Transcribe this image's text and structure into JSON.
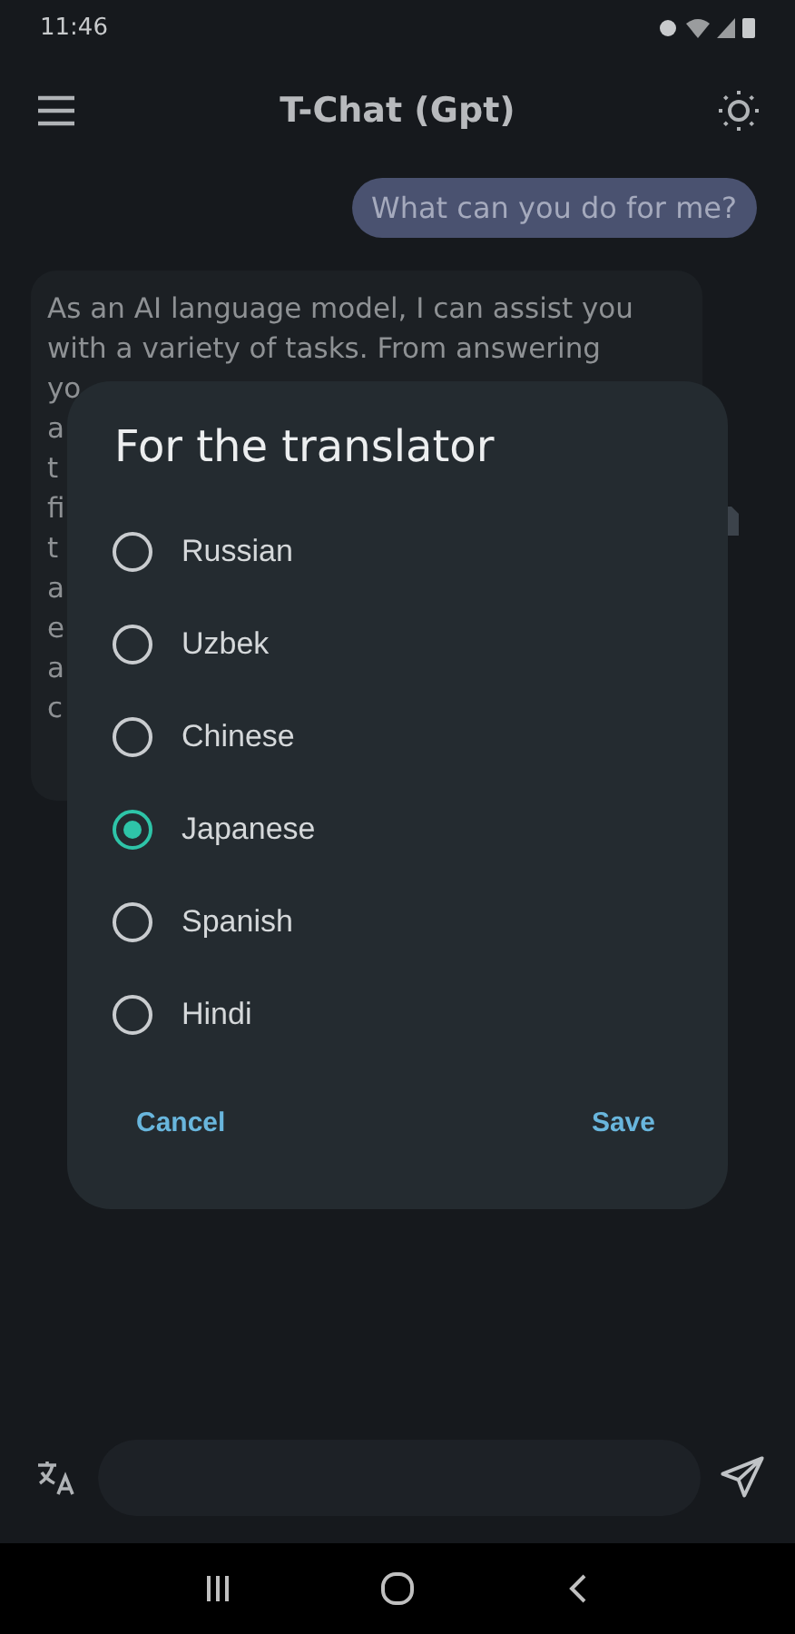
{
  "status_bar": {
    "time": "11:46"
  },
  "app_bar": {
    "title": "T-Chat (Gpt)"
  },
  "user_messages": [
    "What can you do for me?"
  ],
  "bot_messages": [
    {
      "lines": [
        "As an AI language model, I can assist you",
        "with a variety of tasks. From answering",
        "yo",
        "a",
        "t",
        "fi",
        "t",
        "a",
        "e",
        "a",
        "c"
      ]
    }
  ],
  "dialog": {
    "title": "For the translator",
    "options": [
      {
        "label": "Russian",
        "selected": false
      },
      {
        "label": "Uzbek",
        "selected": false
      },
      {
        "label": "Chinese",
        "selected": false
      },
      {
        "label": "Japanese",
        "selected": true
      },
      {
        "label": "Spanish",
        "selected": false
      },
      {
        "label": "Hindi",
        "selected": false
      }
    ],
    "buttons": [
      "Cancel",
      "Save"
    ]
  }
}
